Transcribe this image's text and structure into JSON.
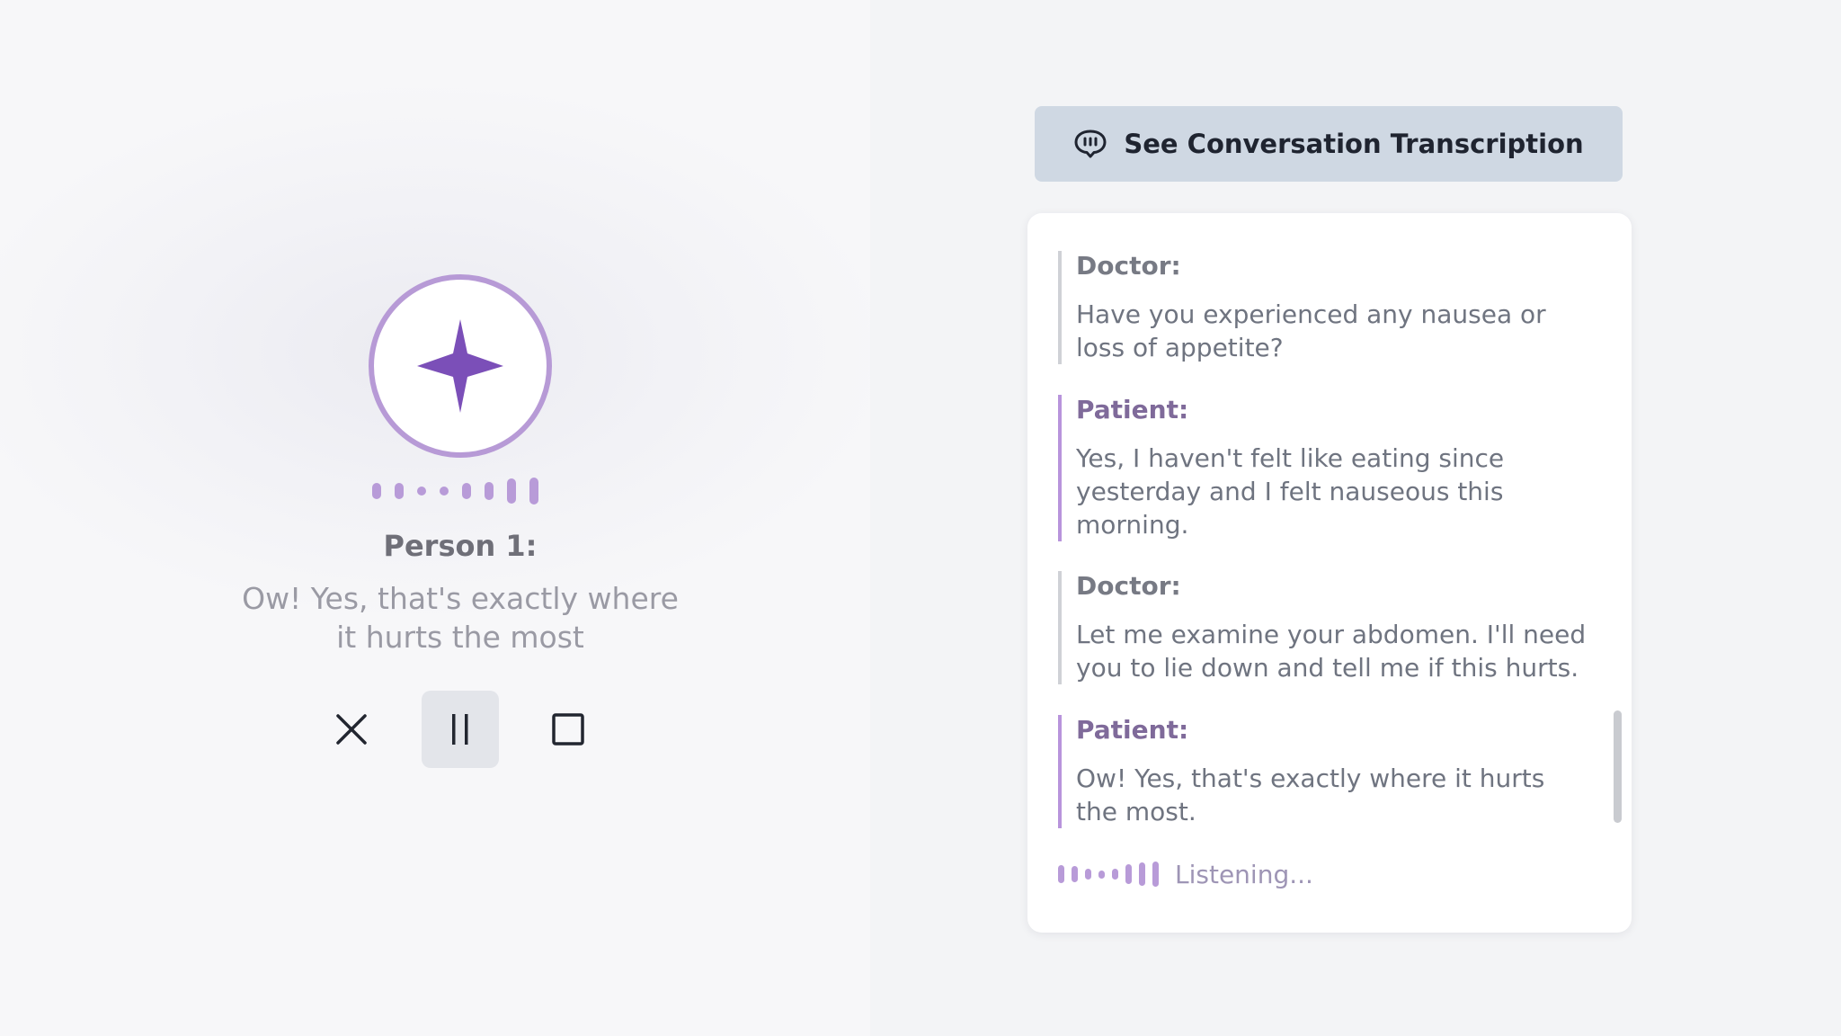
{
  "transcription_button": {
    "label": "See Conversation Transcription",
    "icon": "chat-bubble-icon"
  },
  "active_speaker": {
    "label": "Person 1:",
    "text": "Ow! Yes, that's exactly where it hurts the most",
    "avatar_icon": "sparkle-star-icon"
  },
  "controls": {
    "cancel_icon": "close-icon",
    "pause_icon": "pause-icon",
    "stop_icon": "stop-icon"
  },
  "transcript": {
    "messages": [
      {
        "speaker": "Doctor:",
        "role": "doctor",
        "text": "Have you experienced any nausea or loss of appetite?"
      },
      {
        "speaker": "Patient:",
        "role": "patient",
        "text": "Yes, I haven't felt like eating since yesterday and I felt nauseous this morning."
      },
      {
        "speaker": "Doctor:",
        "role": "doctor",
        "text": "Let me examine your abdomen. I'll need you to lie down and tell me if this hurts."
      },
      {
        "speaker": "Patient:",
        "role": "patient",
        "text": "Ow! Yes, that's exactly where it hurts the most."
      }
    ],
    "status": "Listening..."
  },
  "colors": {
    "accent_purple": "#7b4fb8",
    "ring_purple": "#b79ad6",
    "wave_purple": "#b89bd8",
    "button_bg": "#cfd8e3",
    "doctor_border": "#cfd1d6",
    "patient_border": "#b894dc"
  }
}
